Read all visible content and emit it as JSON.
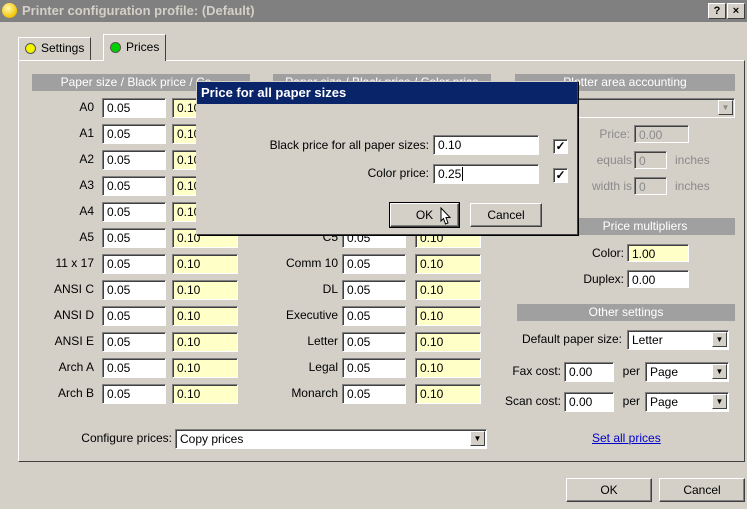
{
  "window": {
    "title": "Printer configuration profile: (Default)",
    "help_btn": "?",
    "close_btn": "×"
  },
  "tabs": [
    {
      "label": "Settings",
      "dot_color": "#f4f400"
    },
    {
      "label": "Prices",
      "dot_color": "#00d000"
    }
  ],
  "headers": {
    "paper_left": "Paper size / Black price / Co...",
    "paper_mid": "Paper size / Black price / Color price",
    "plotter": "Plotter area accounting",
    "multipliers": "Price multipliers",
    "other": "Other settings"
  },
  "paper_left": [
    {
      "label": "A0",
      "black": "0.05",
      "color": "0.10"
    },
    {
      "label": "A1",
      "black": "0.05",
      "color": "0.10"
    },
    {
      "label": "A2",
      "black": "0.05",
      "color": "0.10"
    },
    {
      "label": "A3",
      "black": "0.05",
      "color": "0.10"
    },
    {
      "label": "A4",
      "black": "0.05",
      "color": "0.10"
    },
    {
      "label": "A5",
      "black": "0.05",
      "color": "0.10"
    },
    {
      "label": "11 x 17",
      "black": "0.05",
      "color": "0.10"
    },
    {
      "label": "ANSI C",
      "black": "0.05",
      "color": "0.10"
    },
    {
      "label": "ANSI D",
      "black": "0.05",
      "color": "0.10"
    },
    {
      "label": "ANSI E",
      "black": "0.05",
      "color": "0.10"
    },
    {
      "label": "Arch A",
      "black": "0.05",
      "color": "0.10"
    },
    {
      "label": "Arch B",
      "black": "0.05",
      "color": "0.10"
    }
  ],
  "paper_mid": [
    {
      "label": "C5",
      "black": "0.05",
      "color": "0.10"
    },
    {
      "label": "Comm 10",
      "black": "0.05",
      "color": "0.10"
    },
    {
      "label": "DL",
      "black": "0.05",
      "color": "0.10"
    },
    {
      "label": "Executive",
      "black": "0.05",
      "color": "0.10"
    },
    {
      "label": "Letter",
      "black": "0.05",
      "color": "0.10"
    },
    {
      "label": "Legal",
      "black": "0.05",
      "color": "0.10"
    },
    {
      "label": "Monarch",
      "black": "0.05",
      "color": "0.10"
    }
  ],
  "plotter": {
    "price_label": "Price:",
    "price_value": "0.00",
    "equals_label": "equals",
    "equals_value": "0",
    "equals_unit": "inches",
    "width_label": "width is",
    "width_value": "0",
    "width_unit": "inches"
  },
  "multipliers": {
    "color_label": "Color:",
    "color_value": "1.00",
    "duplex_label": "Duplex:",
    "duplex_value": "0.00"
  },
  "other": {
    "default_paper_label": "Default paper size:",
    "default_paper_value": "Letter",
    "fax_label": "Fax cost:",
    "fax_value": "0.00",
    "fax_per": "per",
    "fax_unit": "Page",
    "scan_label": "Scan cost:",
    "scan_value": "0.00",
    "scan_per": "per",
    "scan_unit": "Page",
    "set_all_link": "Set all prices"
  },
  "configure": {
    "label": "Configure prices:",
    "value": "Copy prices"
  },
  "footer": {
    "ok": "OK",
    "cancel": "Cancel"
  },
  "dialog": {
    "title": "Price for all paper sizes",
    "black_label": "Black price for all paper sizes:",
    "black_value": "0.10",
    "black_checked": "✓",
    "color_label": "Color price:",
    "color_value": "0.25",
    "color_checked": "✓",
    "ok": "OK",
    "cancel": "Cancel"
  }
}
